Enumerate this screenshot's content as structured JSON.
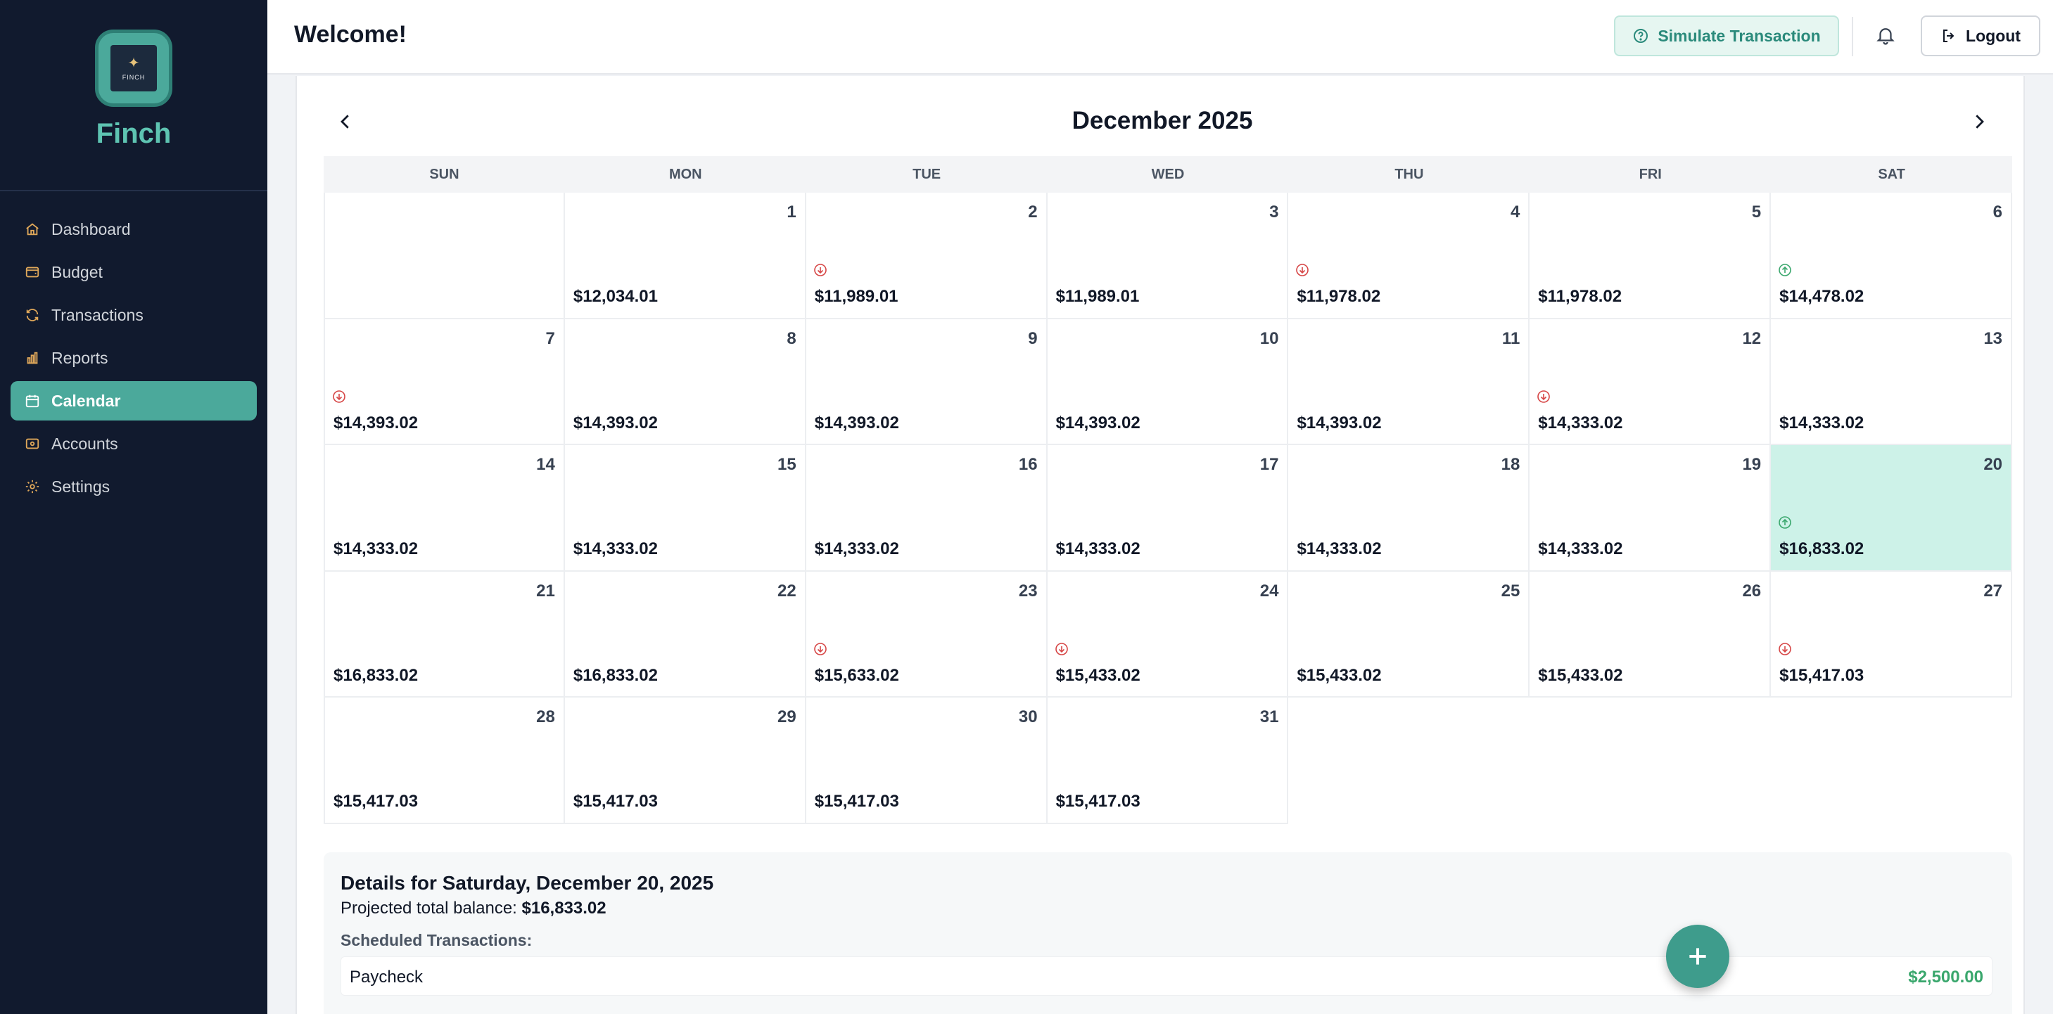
{
  "app": {
    "name": "Finch",
    "logo_text": "FINCH"
  },
  "colors": {
    "sidebar_bg": "#111a2e",
    "accent": "#4ba99b",
    "brand_text": "#5ec4b2",
    "selected_day_bg": "#cdf2e8",
    "income_marker": "#3aa76d",
    "expense_marker": "#d64545"
  },
  "sidebar": {
    "items": [
      {
        "label": "Dashboard",
        "icon": "home-icon",
        "active": false
      },
      {
        "label": "Budget",
        "icon": "wallet-icon",
        "active": false
      },
      {
        "label": "Transactions",
        "icon": "refresh-icon",
        "active": false
      },
      {
        "label": "Reports",
        "icon": "bar-chart-icon",
        "active": false
      },
      {
        "label": "Calendar",
        "icon": "calendar-icon",
        "active": true
      },
      {
        "label": "Accounts",
        "icon": "credit-card-icon",
        "active": false
      },
      {
        "label": "Settings",
        "icon": "gear-icon",
        "active": false
      }
    ]
  },
  "header": {
    "title": "Welcome!",
    "simulate_label": "Simulate Transaction",
    "logout_label": "Logout"
  },
  "calendar": {
    "month_title": "December 2025",
    "weekdays": [
      "SUN",
      "MON",
      "TUE",
      "WED",
      "THU",
      "FRI",
      "SAT"
    ],
    "weeks": [
      [
        null,
        {
          "day": "1",
          "balance": "$12,034.01",
          "marker": null
        },
        {
          "day": "2",
          "balance": "$11,989.01",
          "marker": "expense"
        },
        {
          "day": "3",
          "balance": "$11,989.01",
          "marker": null
        },
        {
          "day": "4",
          "balance": "$11,978.02",
          "marker": "expense"
        },
        {
          "day": "5",
          "balance": "$11,978.02",
          "marker": null
        },
        {
          "day": "6",
          "balance": "$14,478.02",
          "marker": "income"
        }
      ],
      [
        {
          "day": "7",
          "balance": "$14,393.02",
          "marker": "expense"
        },
        {
          "day": "8",
          "balance": "$14,393.02",
          "marker": null
        },
        {
          "day": "9",
          "balance": "$14,393.02",
          "marker": null
        },
        {
          "day": "10",
          "balance": "$14,393.02",
          "marker": null
        },
        {
          "day": "11",
          "balance": "$14,393.02",
          "marker": null
        },
        {
          "day": "12",
          "balance": "$14,333.02",
          "marker": "expense"
        },
        {
          "day": "13",
          "balance": "$14,333.02",
          "marker": null
        }
      ],
      [
        {
          "day": "14",
          "balance": "$14,333.02",
          "marker": null
        },
        {
          "day": "15",
          "balance": "$14,333.02",
          "marker": null
        },
        {
          "day": "16",
          "balance": "$14,333.02",
          "marker": null
        },
        {
          "day": "17",
          "balance": "$14,333.02",
          "marker": null
        },
        {
          "day": "18",
          "balance": "$14,333.02",
          "marker": null
        },
        {
          "day": "19",
          "balance": "$14,333.02",
          "marker": null
        },
        {
          "day": "20",
          "balance": "$16,833.02",
          "marker": "income",
          "selected": true
        }
      ],
      [
        {
          "day": "21",
          "balance": "$16,833.02",
          "marker": null
        },
        {
          "day": "22",
          "balance": "$16,833.02",
          "marker": null
        },
        {
          "day": "23",
          "balance": "$15,633.02",
          "marker": "expense"
        },
        {
          "day": "24",
          "balance": "$15,433.02",
          "marker": "expense"
        },
        {
          "day": "25",
          "balance": "$15,433.02",
          "marker": null
        },
        {
          "day": "26",
          "balance": "$15,433.02",
          "marker": null
        },
        {
          "day": "27",
          "balance": "$15,417.03",
          "marker": "expense"
        }
      ],
      [
        {
          "day": "28",
          "balance": "$15,417.03",
          "marker": null
        },
        {
          "day": "29",
          "balance": "$15,417.03",
          "marker": null
        },
        {
          "day": "30",
          "balance": "$15,417.03",
          "marker": null
        },
        {
          "day": "31",
          "balance": "$15,417.03",
          "marker": null
        },
        null,
        null,
        null
      ]
    ]
  },
  "details": {
    "title": "Details for Saturday, December 20, 2025",
    "projected_label": "Projected total balance:",
    "projected_value": "$16,833.02",
    "scheduled_label": "Scheduled Transactions:",
    "transactions": [
      {
        "name": "Paycheck",
        "amount": "$2,500.00"
      }
    ]
  }
}
